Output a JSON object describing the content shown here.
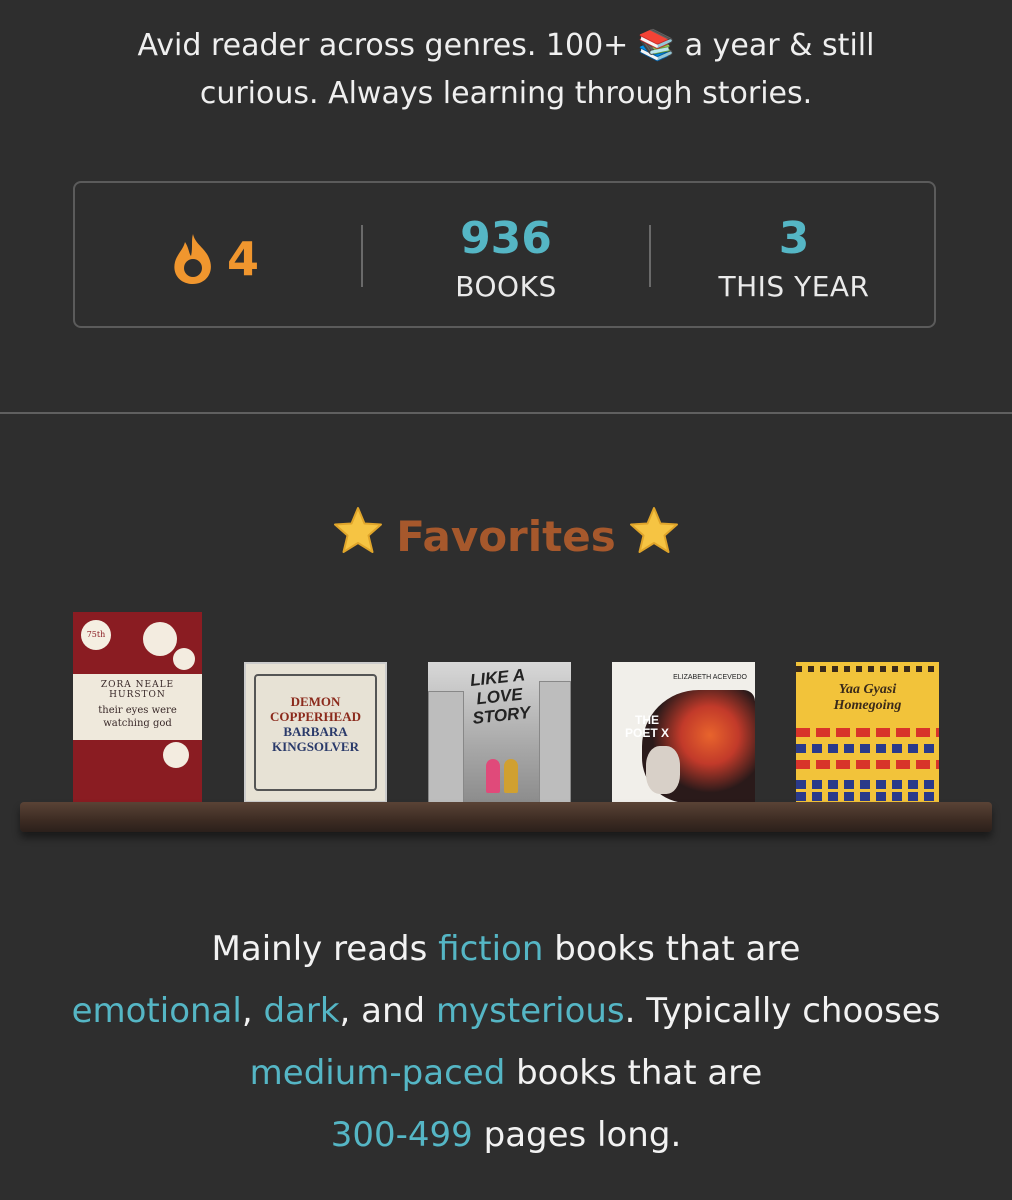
{
  "bio": {
    "line1_a": "Avid reader across genres. 100+ ",
    "books_emoji": "📚",
    "line1_b": " a year & still",
    "line2": "curious. Always learning through stories."
  },
  "stats": {
    "streak_value": "4",
    "books_value": "936",
    "books_label": "BOOKS",
    "this_year_value": "3",
    "this_year_label": "THIS YEAR"
  },
  "favorites": {
    "title": "Favorites",
    "books": [
      {
        "cover_lines": [
          "ZORA NEALE HURSTON",
          "their eyes were",
          "watching god"
        ],
        "badge": "75th"
      },
      {
        "cover_lines": [
          "DEMON",
          "COPPERHEAD",
          "BARBARA",
          "KINGSOLVER"
        ]
      },
      {
        "cover_lines": [
          "LIKE A",
          "LOVE",
          "STORY"
        ]
      },
      {
        "cover_lines": [
          "THE",
          "POET X"
        ],
        "author": "ELIZABETH ACEVEDO"
      },
      {
        "cover_lines": [
          "Yaa Gyasi",
          "Homegoing"
        ]
      }
    ]
  },
  "summary": {
    "p1": "Mainly reads ",
    "genre": "fiction",
    "p2": " books that are ",
    "mood1": "emotional",
    "p3": ", ",
    "mood2": "dark",
    "p4": ", and ",
    "mood3": "mysterious",
    "p5": ". Typically chooses ",
    "pace": "medium-paced",
    "p6": " books that are ",
    "length": "300-499",
    "p7": " pages long."
  },
  "colors": {
    "background": "#2e2e2e",
    "accent_teal": "#55b6c5",
    "streak_orange": "#f0962e",
    "favorites_brown": "#a6582c"
  },
  "icons": [
    "books-emoji",
    "flame-icon",
    "star-icon"
  ]
}
